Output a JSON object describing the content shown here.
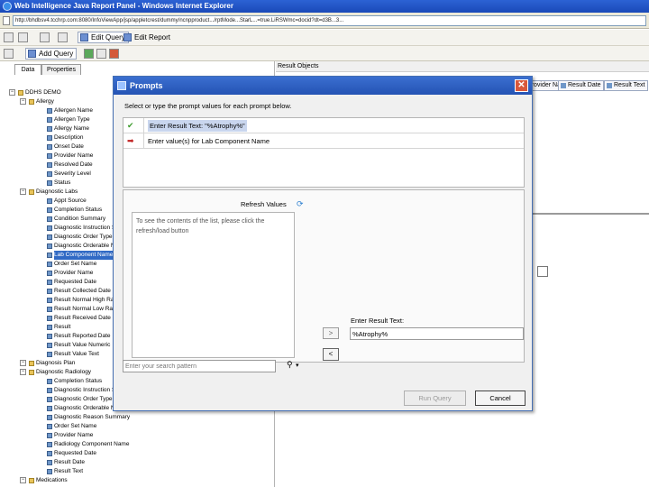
{
  "browser": {
    "title": "Web Intelligence Java Report Panel - Windows Internet Explorer",
    "address": "http://bhdbsv4.tcchrp.com:8080/InfoViewApp/jsp/appletcrest/dummy/ncnpproduct.../rptMode...StarL...=true.LiRSWmc=docid?dt=d3B...3..."
  },
  "toolbar": {
    "edit_query": "Edit Query",
    "edit_report": "Edit Report",
    "add_query": "Add Query"
  },
  "left_panel": {
    "tabs": [
      "Data",
      "Properties"
    ],
    "tree": [
      {
        "label": "DDHS DEMO",
        "level": 0,
        "type": "folder"
      },
      {
        "label": "Allergy",
        "level": 1,
        "type": "folder"
      },
      {
        "label": "Allergen Name",
        "level": 2,
        "type": "object"
      },
      {
        "label": "Allergen Type",
        "level": 2,
        "type": "object"
      },
      {
        "label": "Allergy Name",
        "level": 2,
        "type": "object"
      },
      {
        "label": "Description",
        "level": 2,
        "type": "object"
      },
      {
        "label": "Onset Date",
        "level": 2,
        "type": "object"
      },
      {
        "label": "Provider Name",
        "level": 2,
        "type": "object"
      },
      {
        "label": "Resolved Date",
        "level": 2,
        "type": "object"
      },
      {
        "label": "Severity Level",
        "level": 2,
        "type": "object"
      },
      {
        "label": "Status",
        "level": 2,
        "type": "object"
      },
      {
        "label": "Diagnostic Labs",
        "level": 1,
        "type": "folder"
      },
      {
        "label": "Appt Source",
        "level": 2,
        "type": "object"
      },
      {
        "label": "Completion Status",
        "level": 2,
        "type": "object"
      },
      {
        "label": "Condition Summary",
        "level": 2,
        "type": "object"
      },
      {
        "label": "Diagnostic Instruction S",
        "level": 2,
        "type": "object"
      },
      {
        "label": "Diagnostic Order Type",
        "level": 2,
        "type": "object"
      },
      {
        "label": "Diagnostic Orderable N",
        "level": 2,
        "type": "object"
      },
      {
        "label": "Lab Component Name",
        "level": 2,
        "type": "object",
        "selected": true
      },
      {
        "label": "Order Set Name",
        "level": 2,
        "type": "object"
      },
      {
        "label": "Provider Name",
        "level": 2,
        "type": "object"
      },
      {
        "label": "Requested Date",
        "level": 2,
        "type": "object"
      },
      {
        "label": "Result Collected Date",
        "level": 2,
        "type": "object"
      },
      {
        "label": "Result Normal High Ra",
        "level": 2,
        "type": "object"
      },
      {
        "label": "Result Normal Low Ra",
        "level": 2,
        "type": "object"
      },
      {
        "label": "Result Received Date",
        "level": 2,
        "type": "object"
      },
      {
        "label": "Result",
        "level": 2,
        "type": "object"
      },
      {
        "label": "Result Reported Date",
        "level": 2,
        "type": "object"
      },
      {
        "label": "Result Value Numeric",
        "level": 2,
        "type": "object"
      },
      {
        "label": "Result Value Text",
        "level": 2,
        "type": "object"
      },
      {
        "label": "Diagnosis Plan",
        "level": 1,
        "type": "folder"
      },
      {
        "label": "Diagnostic Radiology",
        "level": 1,
        "type": "folder"
      },
      {
        "label": "Completion Status",
        "level": 2,
        "type": "object"
      },
      {
        "label": "Diagnostic Instruction S",
        "level": 2,
        "type": "object"
      },
      {
        "label": "Diagnostic Order Type",
        "level": 2,
        "type": "object"
      },
      {
        "label": "Diagnostic Orderable Na",
        "level": 2,
        "type": "object"
      },
      {
        "label": "Diagnostic Reason Summary",
        "level": 2,
        "type": "object"
      },
      {
        "label": "Order Set Name",
        "level": 2,
        "type": "object"
      },
      {
        "label": "Provider Name",
        "level": 2,
        "type": "object"
      },
      {
        "label": "Radiology Component Name",
        "level": 2,
        "type": "object"
      },
      {
        "label": "Requested Date",
        "level": 2,
        "type": "object"
      },
      {
        "label": "Result Date",
        "level": 2,
        "type": "object"
      },
      {
        "label": "Result Text",
        "level": 2,
        "type": "object"
      },
      {
        "label": "Medications",
        "level": 1,
        "type": "folder"
      }
    ]
  },
  "right_panel": {
    "header": "Result Objects",
    "chips": [
      "Provider Name",
      "Result Date",
      "Result Text"
    ]
  },
  "dialog": {
    "title": "Prompts",
    "close": "✕",
    "instruction": "Select or type the prompt values for each prompt below.",
    "prompts": [
      {
        "mark": "✔",
        "mark_color": "#3a9a2a",
        "text": "Enter Result Text: \"%Atrophy%\""
      },
      {
        "mark": "➡",
        "mark_color": "#c02020",
        "text": "Enter value(s) for Lab Component Name"
      }
    ],
    "refresh_label": "Refresh Values",
    "values_message": "To see the contents of the list, please click the refresh/load button",
    "search_placeholder": "Enter your search pattern",
    "add_arrow": ">",
    "remove_arrow": "<",
    "result_label": "Enter Result Text:",
    "result_value": "%Atrophy%",
    "run_query": "Run Query",
    "cancel": "Cancel"
  }
}
